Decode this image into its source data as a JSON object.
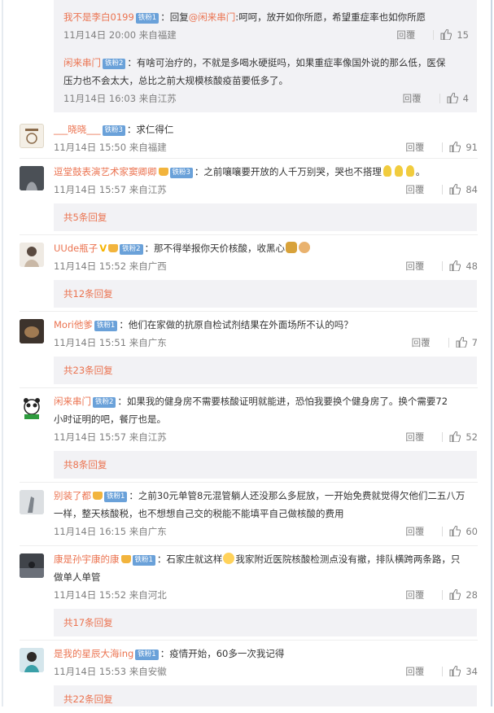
{
  "comments_top_thread": {
    "replies": [
      {
        "user": "我不是李白0199",
        "badge": "铁粉1",
        "text": "：回复",
        "mention": "@闲来串门",
        "text2": ":呵呵，放开如你所愿，希望重症率也如你所愿",
        "time": "11月14日 20:00 来自福建",
        "reply_label": "回覆",
        "likes": "15"
      },
      {
        "user": "闲来串门",
        "badge": "铁粉2",
        "text_line1": "：有啥可治疗的，不就是多喝水硬挺吗，如果重症率像国外说的那么低，医保",
        "text_line2": "压力也不会太大，总比之前大规模核酸疫苗要低多了。",
        "time": "11月14日 16:03 来自江苏",
        "reply_label": "回覆",
        "likes": "4"
      }
    ]
  },
  "comments": [
    {
      "user": "___晓晓___",
      "badge": "铁粉3",
      "text": "：求仁得仁",
      "time": "11月14日 15:50 来自福建",
      "reply_label": "回覆",
      "likes": "91"
    },
    {
      "user": "逗堂鼓表演艺术家窦卿卿",
      "badge": "铁粉3",
      "text": "：之前嚷嚷要开放的人千万别哭，哭也不搭理",
      "time": "11月14日 15:57 来自江苏",
      "reply_label": "回覆",
      "likes": "84",
      "more": "共5条回复"
    },
    {
      "user": "UUde瓶子",
      "badge": "铁粉2",
      "text": "：那不得举报你天价核酸，收黑心",
      "time": "11月14日 15:52 来自广西",
      "reply_label": "回覆",
      "likes": "48",
      "more": "共12条回复"
    },
    {
      "user": "Mori他爹",
      "badge": "铁粉1",
      "text": "：他们在家做的抗原自检试剂结果在外面场所不认的吗？",
      "time": "11月14日 15:51 来自广东",
      "reply_label": "回覆",
      "likes": "7",
      "more": "共23条回复"
    },
    {
      "user": "闲来串门",
      "badge": "铁粉2",
      "text_line1": "：如果我的健身房不需要核酸证明就能进，恐怕我要换个健身房了。换个需要72",
      "text_line2": "小时证明的吧，餐厅也是。",
      "time": "11月14日 15:57 来自江苏",
      "reply_label": "回覆",
      "likes": "52",
      "more": "共8条回复"
    },
    {
      "user": "别装了都",
      "badge": "铁粉1",
      "text_line1": "：之前30元单管8元混管躺人还没那么多屁放，一开始免费就觉得欠他们二五八万",
      "text_line2": "一样，整天核酸税，也不想想自己交的税能不能填平自己做核酸的费用",
      "time": "11月14日 16:15 来自广东",
      "reply_label": "回覆",
      "likes": "60"
    },
    {
      "user": "康是孙宇康的康",
      "badge": "铁粉1",
      "text_line1a": "：石家庄就这样",
      "text_line1b": "我家附近医院核酸检测点没有撤，排队横跨两条路，只",
      "text_line2": "做单人单管",
      "time": "11月14日 15:52 来自河北",
      "reply_label": "回覆",
      "likes": "28",
      "more": "共17条回复"
    },
    {
      "user": "是我的星辰大海ing",
      "badge": "铁粉1",
      "text": "：疫情开始，60多一次我记得",
      "time": "11月14日 15:53 来自安徽",
      "reply_label": "回覆",
      "likes": "34",
      "more": "共22条回复"
    }
  ],
  "colors": {
    "username": "#eb7350",
    "badge": "#6aa1d9",
    "meta": "#808080",
    "sub_bg": "#f2f2f5"
  }
}
